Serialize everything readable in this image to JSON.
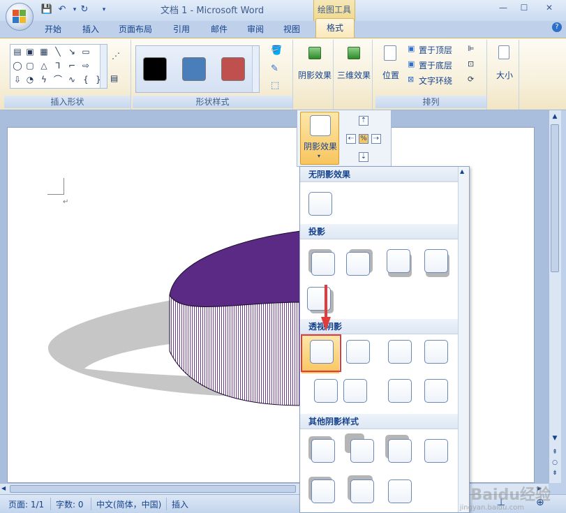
{
  "window": {
    "title": "文档 1 - Microsoft Word",
    "context_group": "绘图工具",
    "minimize": "—",
    "maximize": "☐",
    "close": "✕"
  },
  "tabs": [
    "开始",
    "插入",
    "页面布局",
    "引用",
    "邮件",
    "审阅",
    "视图"
  ],
  "active_tab": "格式",
  "ribbon": {
    "group_insert_shapes": "插入形状",
    "group_shape_styles": "形状样式",
    "group_arrange": "排列",
    "shadow_effects": "阴影效果",
    "effects_3d": "三维效果",
    "position": "位置",
    "bring_to_front": "置于顶层",
    "send_to_back": "置于底层",
    "text_wrap": "文字环绕",
    "size": "大小",
    "swatch_colors": [
      "#000000",
      "#4a7ebb",
      "#c0504d"
    ]
  },
  "shadow_dropdown": {
    "button_label": "阴影效果"
  },
  "gallery": {
    "section_no_shadow": "无阴影效果",
    "section_drop_shadow": "投影",
    "section_perspective": "透视阴影",
    "section_other": "其他阴影样式"
  },
  "statusbar": {
    "page": "页面: 1/1",
    "words": "字数: 0",
    "language": "中文(简体，中国)",
    "mode": "插入"
  },
  "watermark": {
    "brand": "Baidu经验",
    "url": "jingyan.baidu.com"
  },
  "colors": {
    "ring_purple": "#5b2a84",
    "shadow_gray": "#c8c8c8",
    "highlight_red": "#e23b3b"
  }
}
